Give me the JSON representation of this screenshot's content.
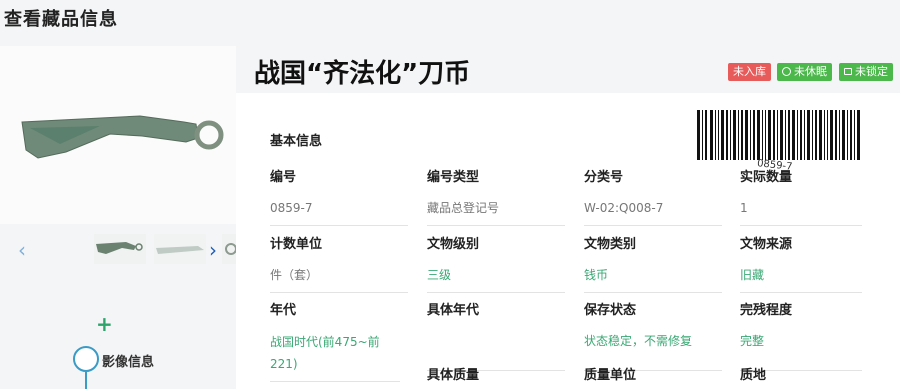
{
  "page": {
    "title": "查看藏品信息"
  },
  "item": {
    "title": "战国“齐法化”刀币",
    "badges": {
      "status": "未入库",
      "hibernate": "未休眠",
      "lock": "未锁定"
    },
    "barcode_text": "0859-7"
  },
  "section": {
    "basic_info": "基本信息"
  },
  "fields": {
    "r1": [
      {
        "label": "编号",
        "value": "0859-7"
      },
      {
        "label": "编号类型",
        "value": "藏品总登记号"
      },
      {
        "label": "分类号",
        "value": "W-02:Q008-7"
      },
      {
        "label": "实际数量",
        "value": "1"
      }
    ],
    "r2": [
      {
        "label": "计数单位",
        "value": "件（套）"
      },
      {
        "label": "文物级别",
        "value": "三级"
      },
      {
        "label": "文物类别",
        "value": "钱币"
      },
      {
        "label": "文物来源",
        "value": "旧藏"
      }
    ],
    "r3": [
      {
        "label": "年代",
        "value": "战国时代(前475~前221)"
      },
      {
        "label": "具体年代",
        "value": ""
      },
      {
        "label": "保存状态",
        "value": "状态稳定，不需修复"
      },
      {
        "label": "完残程度",
        "value": "完整"
      }
    ],
    "r4": [
      {
        "label": "具体质量"
      },
      {
        "label": "质量单位"
      },
      {
        "label": "质地"
      }
    ]
  },
  "sidebar": {
    "timeline_label": "影像信息"
  },
  "colors": {
    "green": "#3aa874",
    "red_badge": "#e85b5b",
    "green_badge": "#4cb84c"
  }
}
